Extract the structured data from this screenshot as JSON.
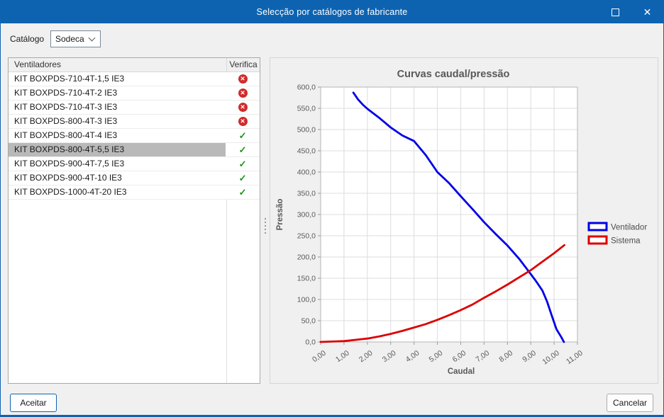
{
  "titlebar": {
    "title": "Selecção por catálogos de fabricante"
  },
  "toolbar": {
    "catalog_label": "Catálogo",
    "catalog_value": "Sodeca"
  },
  "list": {
    "name_header": "Ventiladores",
    "verify_header": "Verifica",
    "rows": [
      {
        "name": "KIT BOXPDS-710-4T-1,5 IE3",
        "status": "fail",
        "selected": false
      },
      {
        "name": "KIT BOXPDS-710-4T-2 IE3",
        "status": "fail",
        "selected": false
      },
      {
        "name": "KIT BOXPDS-710-4T-3 IE3",
        "status": "fail",
        "selected": false
      },
      {
        "name": "KIT BOXPDS-800-4T-3 IE3",
        "status": "fail",
        "selected": false
      },
      {
        "name": "KIT BOXPDS-800-4T-4 IE3",
        "status": "pass",
        "selected": false
      },
      {
        "name": "KIT BOXPDS-800-4T-5,5 IE3",
        "status": "pass",
        "selected": true
      },
      {
        "name": "KIT BOXPDS-900-4T-7,5 IE3",
        "status": "pass",
        "selected": false
      },
      {
        "name": "KIT BOXPDS-900-4T-10 IE3",
        "status": "pass",
        "selected": false
      },
      {
        "name": "KIT BOXPDS-1000-4T-20 IE3",
        "status": "pass",
        "selected": false
      }
    ]
  },
  "chart_data": {
    "type": "line",
    "title": "Curvas caudal/pressão",
    "xlabel": "Caudal",
    "ylabel": "Pressão",
    "xlim": [
      0,
      11
    ],
    "ylim": [
      0,
      600
    ],
    "grid": true,
    "legend_position": "right",
    "x_ticks": [
      "0,00",
      "1,00",
      "2,00",
      "3,00",
      "4,00",
      "5,00",
      "6,00",
      "7,00",
      "8,00",
      "9,00",
      "10,00",
      "11,00"
    ],
    "y_ticks": [
      "600,0",
      "550,0",
      "500,0",
      "450,0",
      "400,0",
      "350,0",
      "300,0",
      "250,0",
      "200,0",
      "150,0",
      "100,0",
      "50,0",
      "0,0"
    ],
    "series": [
      {
        "name": "Ventilador",
        "color": "#0000e6",
        "points": [
          [
            1.4,
            587
          ],
          [
            1.6,
            571
          ],
          [
            1.8,
            559
          ],
          [
            2.0,
            549
          ],
          [
            2.5,
            528
          ],
          [
            3.0,
            505
          ],
          [
            3.5,
            486
          ],
          [
            4.0,
            473
          ],
          [
            4.5,
            440
          ],
          [
            5.0,
            400
          ],
          [
            5.5,
            374
          ],
          [
            6.0,
            343
          ],
          [
            6.5,
            313
          ],
          [
            7.0,
            282
          ],
          [
            7.5,
            254
          ],
          [
            8.0,
            227
          ],
          [
            8.5,
            196
          ],
          [
            8.9,
            167
          ],
          [
            9.2,
            145
          ],
          [
            9.5,
            121
          ],
          [
            9.7,
            95
          ],
          [
            9.9,
            62
          ],
          [
            10.1,
            30
          ],
          [
            10.3,
            12
          ],
          [
            10.42,
            0
          ]
        ]
      },
      {
        "name": "Sistema",
        "color": "#dc0000",
        "points": [
          [
            0,
            0
          ],
          [
            0.5,
            1
          ],
          [
            1,
            2
          ],
          [
            1.5,
            5
          ],
          [
            2,
            8
          ],
          [
            2.5,
            13
          ],
          [
            3,
            19
          ],
          [
            3.5,
            26
          ],
          [
            4,
            34
          ],
          [
            4.5,
            42
          ],
          [
            5,
            52
          ],
          [
            5.5,
            63
          ],
          [
            6,
            75
          ],
          [
            6.5,
            88
          ],
          [
            7,
            104
          ],
          [
            7.5,
            119
          ],
          [
            8,
            135
          ],
          [
            8.5,
            152
          ],
          [
            9,
            169
          ],
          [
            9.5,
            189
          ],
          [
            10,
            209
          ],
          [
            10.44,
            228
          ]
        ]
      }
    ]
  },
  "footer": {
    "accept_label": "Aceitar",
    "cancel_label": "Cancelar"
  },
  "colors": {
    "titlebar": "#0e63b1",
    "pass": "#1c941c",
    "fail": "#d02b2b",
    "selected_row": "#b9b9b9"
  }
}
